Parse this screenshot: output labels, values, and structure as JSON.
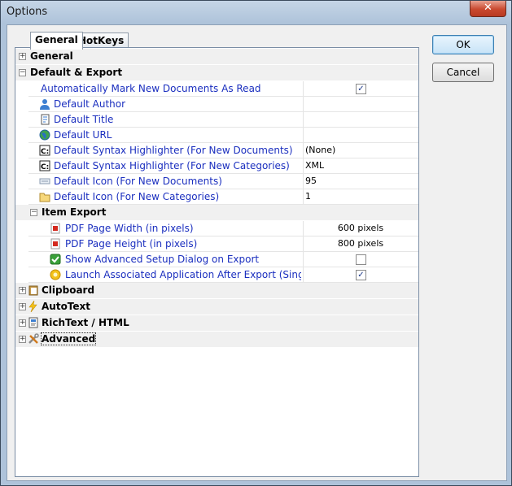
{
  "window": {
    "title": "Options",
    "close_label": "✕"
  },
  "tabs": [
    {
      "label": "General"
    },
    {
      "label": "HotKeys"
    }
  ],
  "buttons": {
    "ok": "OK",
    "cancel": "Cancel"
  },
  "groups": {
    "general": "General",
    "default_export": "Default & Export",
    "item_export": "Item Export",
    "clipboard": "Clipboard",
    "autotext": "AutoText",
    "richtext": "RichText / HTML",
    "advanced": "Advanced"
  },
  "default_export": [
    {
      "name": "Automatically Mark New Documents As Read",
      "type": "checkbox",
      "checked": true
    },
    {
      "name": "Default Author",
      "value": ""
    },
    {
      "name": "Default Title",
      "value": ""
    },
    {
      "name": "Default URL",
      "value": ""
    },
    {
      "name": "Default Syntax Highlighter (For New Documents)",
      "value": "(None)"
    },
    {
      "name": "Default Syntax Highlighter (For New Categories)",
      "value": "XML"
    },
    {
      "name": "Default Icon (For New Documents)",
      "value": "95"
    },
    {
      "name": "Default Icon (For New Categories)",
      "value": "1"
    }
  ],
  "item_export": [
    {
      "name": "PDF Page Width (in pixels)",
      "value": "600 pixels"
    },
    {
      "name": "PDF Page Height (in pixels)",
      "value": "800 pixels"
    },
    {
      "name": "Show Advanced Setup Dialog on Export",
      "type": "checkbox",
      "checked": false
    },
    {
      "name": "Launch Associated Application After Export (Single Fi...",
      "type": "checkbox",
      "checked": true
    }
  ],
  "check_mark": "✓",
  "expander": {
    "collapsed": "+",
    "expanded": "−"
  },
  "colors": {
    "property_text": "#1b2fbf",
    "title_bar": "#aec3da",
    "close": "#c9492f"
  }
}
